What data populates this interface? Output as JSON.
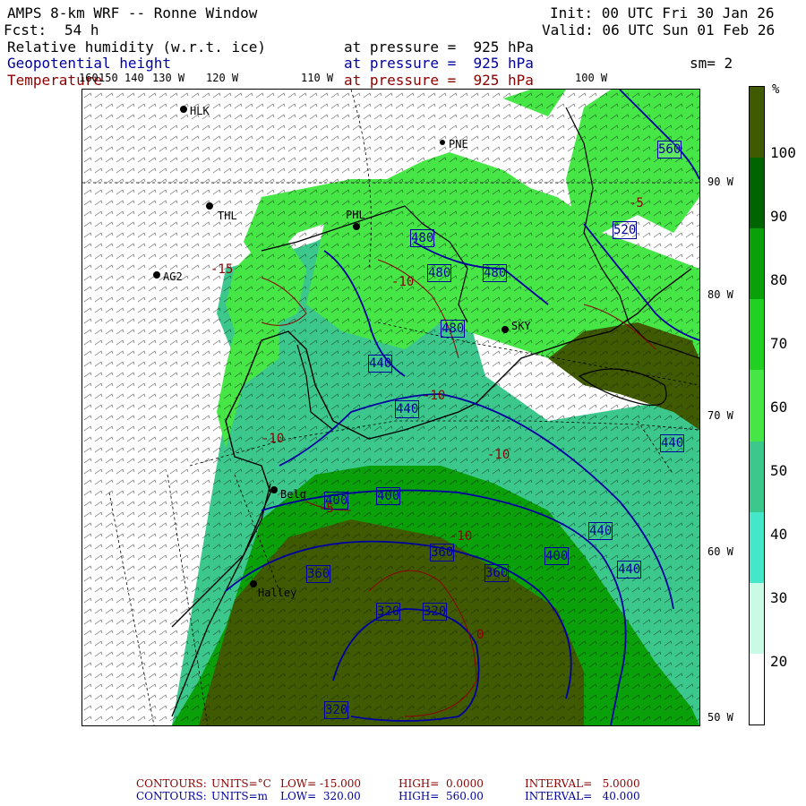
{
  "header": {
    "title": "AMPS 8-km WRF -- Ronne Window",
    "init": "Init: 00 UTC Fri 30 Jan 26",
    "fcst_label": "Fcst:",
    "fcst_value": "54 h",
    "valid": "Valid: 06 UTC Sun 01 Feb 26"
  },
  "fields": [
    {
      "name": "Relative humidity (w.r.t. ice)",
      "level": "at pressure =  925 hPa",
      "color": "#000000"
    },
    {
      "name": "Geopotential height",
      "level": "at pressure =  925 hPa",
      "color": "#0000a0"
    },
    {
      "name": "Temperature",
      "level": "at pressure =  925 hPa",
      "color": "#8b0000"
    }
  ],
  "smoothing": "sm= 2",
  "longitude_labels": [
    "160",
    "150",
    "140",
    "130 W",
    "120 W",
    "110 W",
    "100 W"
  ],
  "latitude_labels": [
    "90 W",
    "80 W",
    "70 W",
    "60 W",
    "50 W"
  ],
  "stations": [
    {
      "id": "HLK"
    },
    {
      "id": "PNE"
    },
    {
      "id": "THL"
    },
    {
      "id": "PHL"
    },
    {
      "id": "AG2"
    },
    {
      "id": "SKY"
    },
    {
      "id": "Belg"
    },
    {
      "id": "Halley"
    }
  ],
  "height_contour_labels": [
    "560",
    "520",
    "480",
    "480",
    "480",
    "480",
    "440",
    "440",
    "400",
    "400",
    "400",
    "440",
    "440",
    "360",
    "360",
    "360",
    "320",
    "320",
    "320",
    "440"
  ],
  "temp_contour_labels": [
    "-15",
    "-10",
    "-10",
    "-5",
    "-10",
    "-10",
    "-5",
    "-10",
    "0"
  ],
  "legend": {
    "unit": "%",
    "ticks": [
      "100",
      "90",
      "80",
      "70",
      "60",
      "50",
      "40",
      "30",
      "20"
    ],
    "colors": [
      "#3f5a00",
      "#006400",
      "#0aa00a",
      "#22d022",
      "#46e646",
      "#3cc88c",
      "#46e6c8",
      "#c8fae6",
      "#ffffff"
    ]
  },
  "footer": {
    "temp": {
      "label": "CONTOURS:",
      "units": "UNITS=°C",
      "low": "LOW= -15.000",
      "high": "HIGH=  0.0000",
      "interval": "INTERVAL=   5.0000"
    },
    "height": {
      "label": "CONTOURS:",
      "units": "UNITS=m",
      "low": "LOW=  320.00",
      "high": "HIGH=  560.00",
      "interval": "INTERVAL=   40.000"
    }
  }
}
